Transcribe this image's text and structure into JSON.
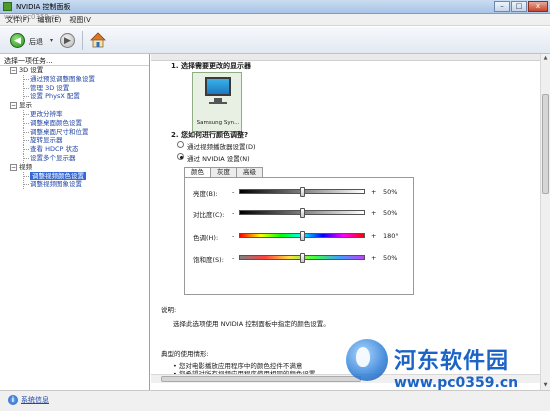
{
  "window": {
    "title": "NVIDIA 控制面板",
    "watermark_top": "www.pc0359.cn",
    "buttons": {
      "minimize": "–",
      "maximize": "□",
      "close": "x"
    }
  },
  "menu": [
    "文件(F)",
    "编辑(E)",
    "视图(V"
  ],
  "toolbar": {
    "back_label": "后退",
    "back_icon": "back-arrow-icon",
    "forward_icon": "forward-arrow-icon",
    "home_icon": "home-icon"
  },
  "left_panel": {
    "header": "选择一项任务...",
    "tree": [
      {
        "type": "cat",
        "expander": "−",
        "label": "3D 设置"
      },
      {
        "type": "leaf",
        "label": "通过预览调整图象设置"
      },
      {
        "type": "leaf",
        "label": "管理 3D 设置"
      },
      {
        "type": "leaf",
        "label": "设置 PhysX 配置"
      },
      {
        "type": "cat",
        "expander": "−",
        "label": "显示"
      },
      {
        "type": "leaf",
        "label": "更改分辨率"
      },
      {
        "type": "leaf",
        "label": "调整桌面颜色设置"
      },
      {
        "type": "leaf",
        "label": "调整桌面尺寸和位置"
      },
      {
        "type": "leaf",
        "label": "旋转显示器"
      },
      {
        "type": "leaf",
        "label": "查看 HDCP 状态"
      },
      {
        "type": "leaf",
        "label": "设置多个显示器"
      },
      {
        "type": "cat",
        "expander": "−",
        "label": "视频"
      },
      {
        "type": "leaf",
        "label": "调整视频颜色设置",
        "selected": true
      },
      {
        "type": "leaf",
        "label": "调整视频图象设置"
      }
    ],
    "system_info": "系统信息"
  },
  "main": {
    "section1_title": "1. 选择需要更改的显示器",
    "monitor_label": "Samsung Syn...",
    "section2_title": "2. 您如何进行颜色调整?",
    "radio_player": "通过视频播放器设置(D)",
    "radio_nvidia": "通过 NVIDIA 设置(N)",
    "tabs": [
      "颜色",
      "灰度",
      "高级"
    ],
    "sliders": [
      {
        "label": "亮度(B):",
        "minus": "-",
        "plus": "+",
        "value": "50%",
        "position": 0.5,
        "style": "bw"
      },
      {
        "label": "对比度(C):",
        "minus": "-",
        "plus": "+",
        "value": "50%",
        "position": 0.5,
        "style": "bw"
      },
      {
        "label": "色调(H):",
        "minus": "-",
        "plus": "+",
        "value": "180°",
        "position": 0.5,
        "style": "hue"
      },
      {
        "label": "饱和度(S):",
        "minus": "-",
        "plus": "+",
        "value": "50%",
        "position": 0.5,
        "style": "sat"
      }
    ],
    "description_head": "说明:",
    "description_text": "选择此选项使用 NVIDIA 控制面板中指定的颜色设置。",
    "typical_head": "典型的使用情形:",
    "typical_items": [
      "• 您对电影播放应用程序中的颜色控件不满意",
      "• 您希望对所有视频应用程序使用相同的颜色设置"
    ]
  },
  "watermark": {
    "brand": "河东软件园",
    "url": "www.pc0359.cn"
  },
  "colors": {
    "selection": "#3369d6",
    "link": "#2446a6",
    "watermark": "#1b64c6"
  }
}
